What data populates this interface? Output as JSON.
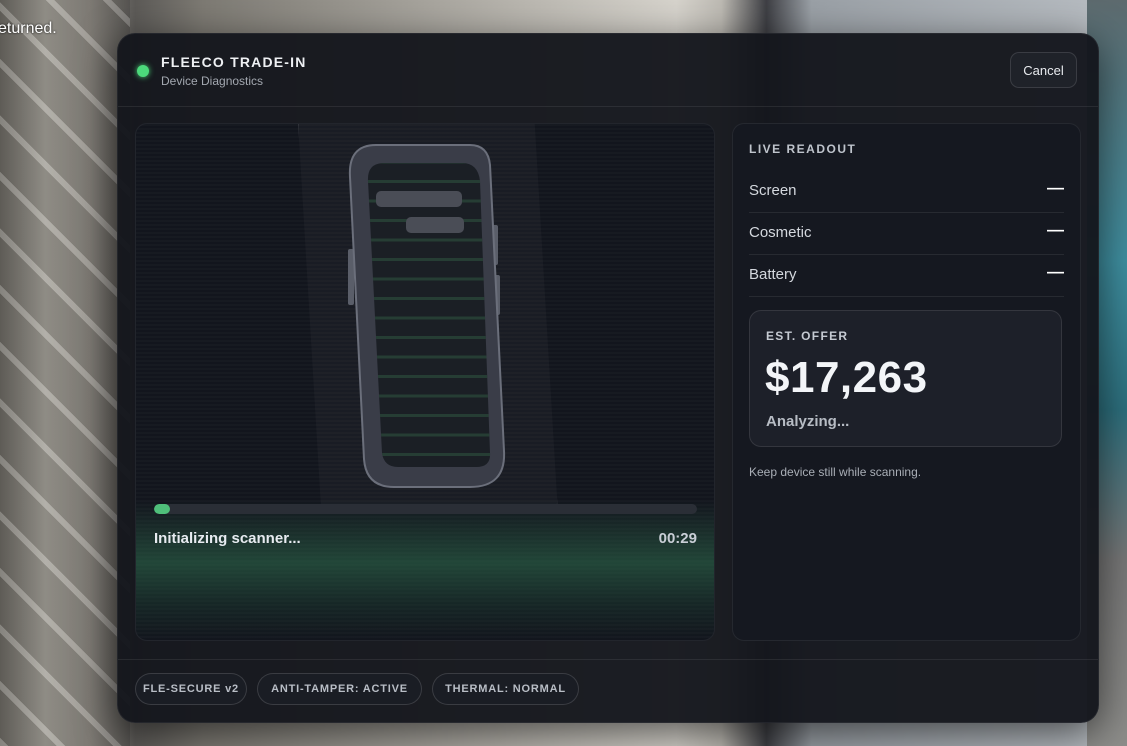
{
  "background": {
    "text": "eturned."
  },
  "header": {
    "status_color": "#4cd97b",
    "title": "FLEECO TRADE-IN",
    "subtitle": "Device Diagnostics",
    "cancel_label": "Cancel"
  },
  "scanner": {
    "progress_fraction": 0.03,
    "status_text": "Initializing scanner...",
    "timer": "00:29",
    "accent_color": "#4fbf7a"
  },
  "readout": {
    "title": "LIVE READOUT",
    "rows": [
      {
        "label": "Screen",
        "value": "—"
      },
      {
        "label": "Cosmetic",
        "value": "—"
      },
      {
        "label": "Battery",
        "value": "—"
      }
    ],
    "offer": {
      "label": "EST. OFFER",
      "amount": "$17,263",
      "status": "Analyzing..."
    },
    "hint": "Keep device still while scanning."
  },
  "footer": {
    "chips": [
      {
        "label": "FLE-SECURE v2"
      },
      {
        "label": "ANTI-TAMPER: ACTIVE"
      },
      {
        "label": "THERMAL: NORMAL"
      }
    ]
  }
}
